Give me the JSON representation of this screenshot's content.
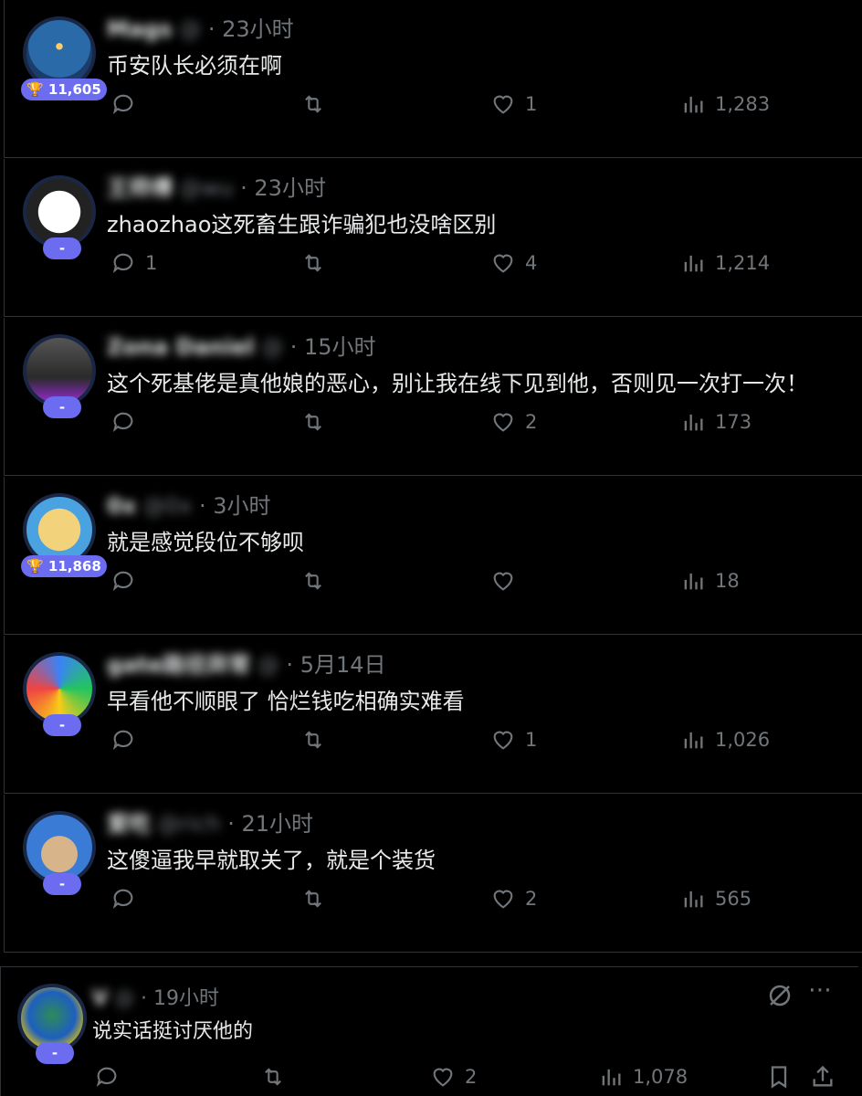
{
  "replies": [
    {
      "name": "Mags",
      "handle": "@",
      "time": "23小时",
      "text": "币安队长必须在啊",
      "badge": "11,605",
      "trophy": true,
      "replies": "",
      "likes": "1",
      "views": "1,283"
    },
    {
      "name": "王师傅",
      "handle": "@wu",
      "time": "23小时",
      "text": "zhaozhao这死畜生跟诈骗犯也没啥区别",
      "badge": "-",
      "trophy": false,
      "replies": "1",
      "likes": "4",
      "views": "1,214"
    },
    {
      "name": "Zona Daniel",
      "handle": "@",
      "time": "15小时",
      "text": "这个死基佬是真他娘的恶心，别让我在线下见到他，否则见一次打一次！",
      "badge": "-",
      "trophy": false,
      "replies": "",
      "likes": "2",
      "views": "173"
    },
    {
      "name": "0x",
      "handle": "@0x",
      "time": "3小时",
      "text": "就是感觉段位不够呗",
      "badge": "11,868",
      "trophy": true,
      "replies": "",
      "likes": "",
      "views": "18"
    },
    {
      "name": "gate路径异常",
      "handle": "@",
      "time": "5月14日",
      "text": "早看他不顺眼了 恰烂钱吃相确实难看",
      "badge": "-",
      "trophy": false,
      "replies": "",
      "likes": "1",
      "views": "1,026"
    },
    {
      "name": "爱吃",
      "handle": "@rich",
      "time": "21小时",
      "text": "这傻逼我早就取关了，就是个装货",
      "badge": "-",
      "trophy": false,
      "replies": "",
      "likes": "2",
      "views": "565"
    }
  ],
  "last": {
    "name": "V",
    "handle": "@",
    "time": "19小时",
    "text": "说实话挺讨厌他的",
    "badge": "-",
    "replies": "",
    "likes": "2",
    "views": "1,078"
  },
  "misc": {
    "sep": "·",
    "trophy": "🏆"
  }
}
